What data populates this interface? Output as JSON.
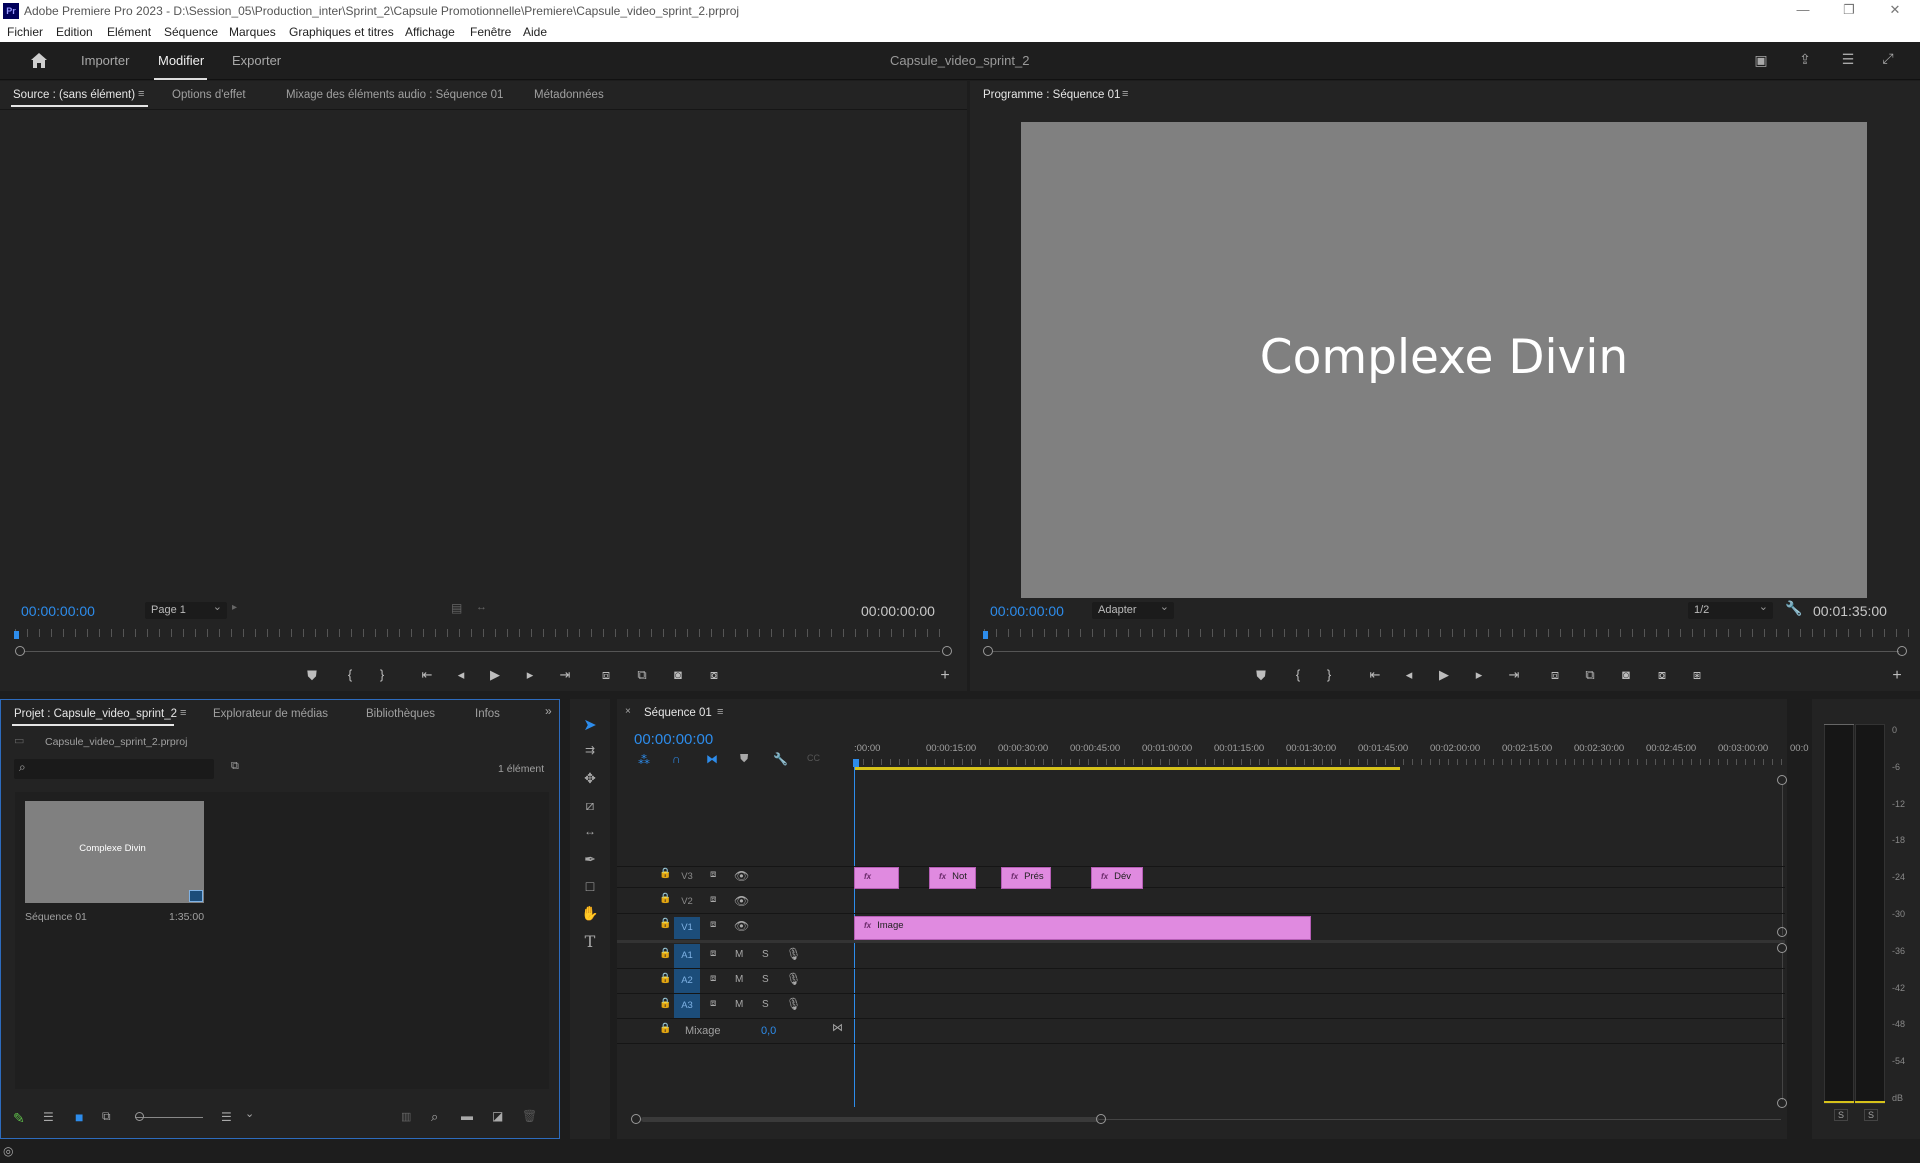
{
  "titlebar": {
    "app_icon": "Pr",
    "title": "Adobe Premiere Pro 2023 - D:\\Session_05\\Production_inter\\Sprint_2\\Capsule Promotionnelle\\Premiere\\Capsule_video_sprint_2.prproj",
    "minimize": "—",
    "restore": "❐",
    "close": "✕"
  },
  "menu": [
    "Fichier",
    "Edition",
    "Elément",
    "Séquence",
    "Marques",
    "Graphiques et titres",
    "Affichage",
    "Fenêtre",
    "Aide"
  ],
  "workspace": {
    "tabs": [
      "Importer",
      "Modifier",
      "Exporter"
    ],
    "active_tab": "Modifier",
    "project_name": "Capsule_video_sprint_2"
  },
  "source": {
    "tabs": [
      "Source : (sans élément)",
      "Options d'effet",
      "Mixage des éléments audio : Séquence 01",
      "Métadonnées"
    ],
    "timecode_in": "00:00:00:00",
    "page_dropdown": "Page 1",
    "timecode_out": "00:00:00:00"
  },
  "program": {
    "tab": "Programme : Séquence 01",
    "frame_text": "Complexe Divin",
    "timecode_in": "00:00:00:00",
    "fit_dropdown": "Adapter",
    "resolution_dropdown": "1/2",
    "duration": "00:01:35:00"
  },
  "project": {
    "tabs": [
      "Projet : Capsule_video_sprint_2",
      "Explorateur de médias",
      "Bibliothèques",
      "Infos"
    ],
    "file": "Capsule_video_sprint_2.prproj",
    "count": "1 élément",
    "items": [
      {
        "thumb_text": "Complexe Divin",
        "name": "Séquence 01",
        "duration": "1:35:00"
      }
    ]
  },
  "timeline": {
    "tab": "Séquence 01",
    "timecode": "00:00:00:00",
    "ruler": [
      ":00:00",
      "00:00:15:00",
      "00:00:30:00",
      "00:00:45:00",
      "00:01:00:00",
      "00:01:15:00",
      "00:01:30:00",
      "00:01:45:00",
      "00:02:00:00",
      "00:02:15:00",
      "00:02:30:00",
      "00:02:45:00",
      "00:03:00:00",
      "00:0"
    ],
    "video_tracks": [
      "V3",
      "V2",
      "V1"
    ],
    "audio_tracks": [
      "A1",
      "A2",
      "A3"
    ],
    "mute": "M",
    "solo": "S",
    "mix_label": "Mixage",
    "mix_value": "0,0",
    "clips_v3": [
      "",
      "Not",
      "Prés",
      "Dév"
    ],
    "clip_v1": "Image",
    "fx": "fx"
  },
  "meter": {
    "scale": [
      "0",
      "-6",
      "-12",
      "-18",
      "-24",
      "-30",
      "-36",
      "-42",
      "-48",
      "-54",
      "dB"
    ],
    "solo_buttons": [
      "S",
      "S"
    ]
  },
  "colors": {
    "accent_blue": "#2d8ceb",
    "clip_pink": "#e08ae0",
    "selected_track": "#1c4d7a",
    "work_area_yellow": "#d6c21a"
  }
}
